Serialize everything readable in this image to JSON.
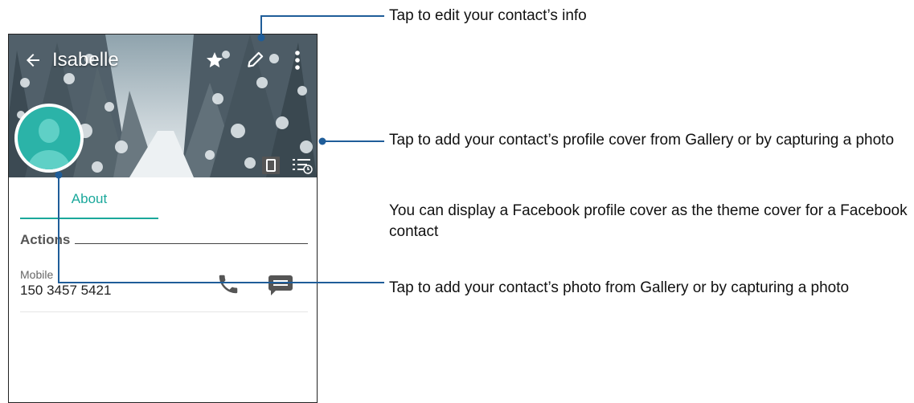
{
  "contact": {
    "name": "Isabelle",
    "tab_label": "About",
    "actions_heading": "Actions",
    "mobile_label": "Mobile",
    "mobile_number": "150 3457 5421"
  },
  "icons": {
    "back": "arrow-back-icon",
    "favorite": "star-icon",
    "edit": "pencil-icon",
    "more": "more-vertical-icon",
    "cover_a": "phone-portrait-icon",
    "cover_b": "list-clock-icon",
    "avatar": "person-silhouette-icon",
    "call": "phone-icon",
    "message": "chat-bubble-icon"
  },
  "callouts": {
    "edit": "Tap to edit your contact’s info",
    "cover": "Tap to add your contact’s profile cover from Gallery or by capturing a photo",
    "facebook": "You can display a Facebook profile cover as the theme cover for a Facebook contact",
    "photo": "Tap to add your contact’s photo from Gallery or by capturing a photo"
  },
  "colors": {
    "accent": "#1aa89b",
    "avatar": "#2bb3a8",
    "connector": "#1f5d99"
  }
}
